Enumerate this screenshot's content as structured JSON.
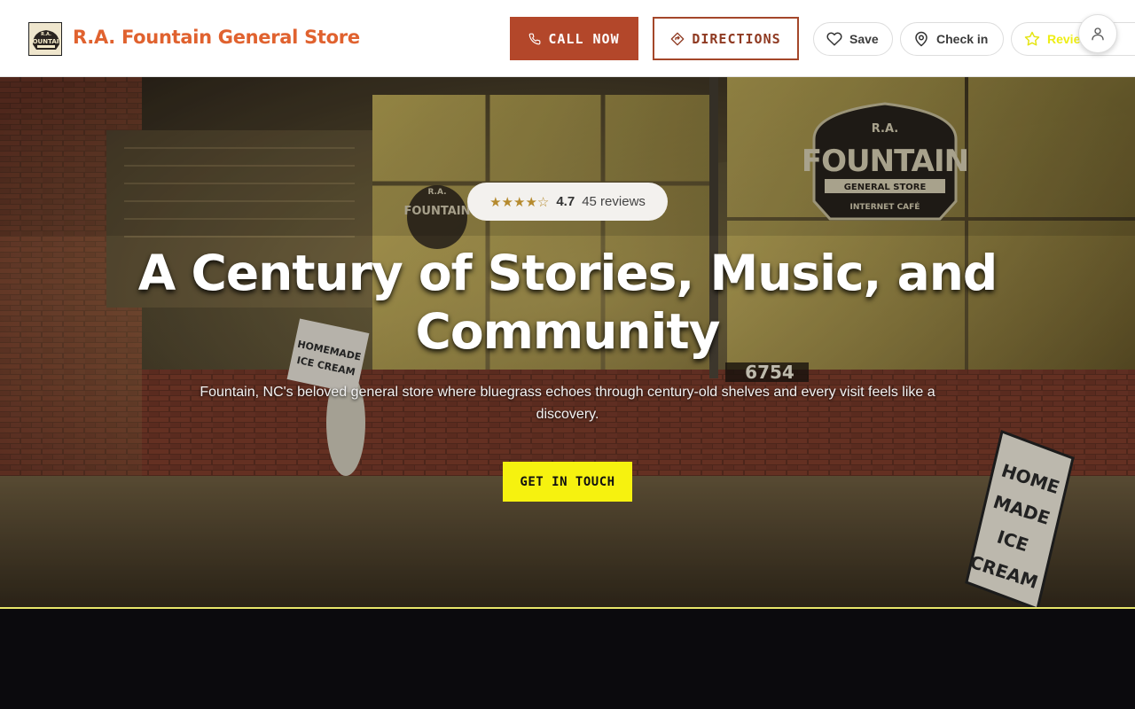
{
  "header": {
    "brand": "R.A. Fountain General Store",
    "logo_text_top": "R.A.",
    "logo_text_main": "FOUNTAIN",
    "call_label": "CALL NOW",
    "directions_label": "DIRECTIONS",
    "save_label": "Save",
    "checkin_label": "Check in",
    "review_label": "Review"
  },
  "hero": {
    "rating": "4.7",
    "review_count": "45 reviews",
    "stars_filled": 4.5,
    "title_line1": "A Century of Stories, Music, and",
    "title_line2": "Community",
    "subtitle": "Fountain, NC's beloved general store where bluegrass echoes through century-old shelves and every visit feels like a discovery.",
    "cta_label": "GET IN TOUCH",
    "sign_left": "HOMEMADE ICE CREAM",
    "sign_right": "HOME MADE ICE CREAM",
    "store_sign_top": "R.A.",
    "store_sign_main": "FOUNTAIN",
    "store_sign_sub": "GENERAL STORE",
    "store_sign_sub2": "INTERNET CAFÉ",
    "door_number": "6754"
  },
  "colors": {
    "brand": "#e0622f",
    "call_bg": "#b3472a",
    "cta_bg": "#f6f20f",
    "review_accent": "#eeee14"
  }
}
